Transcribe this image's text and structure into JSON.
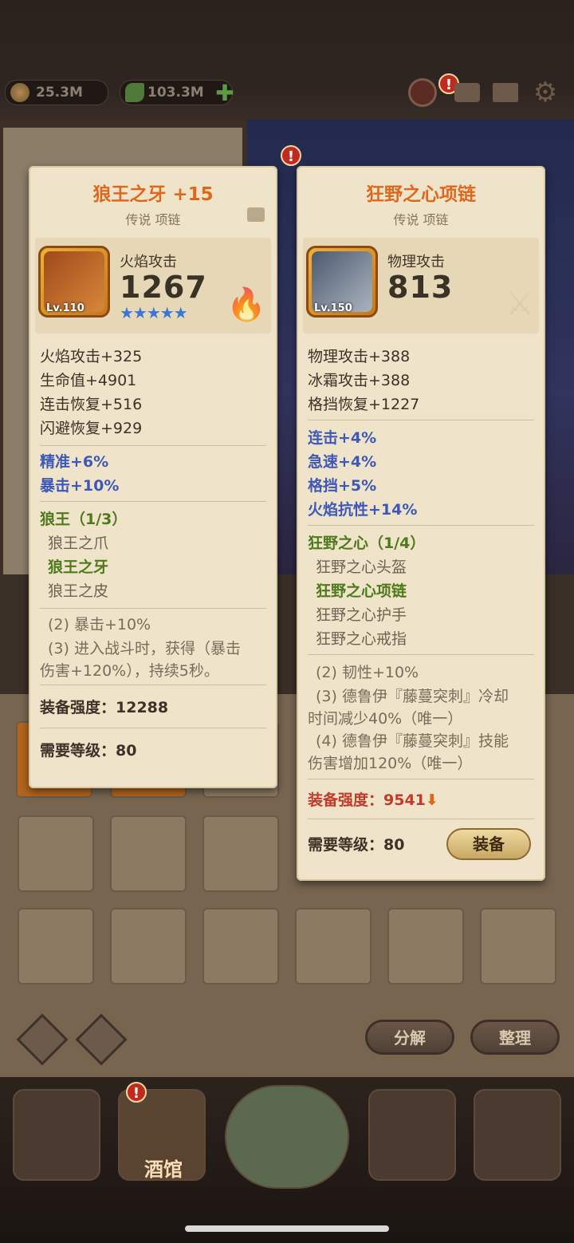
{
  "resources": {
    "coins": "25.3M",
    "gems": "103.3M"
  },
  "top_badges": {
    "bag": "!"
  },
  "card_left": {
    "title": "狼王之牙 +15",
    "subtitle": "传说 项链",
    "level": "Lv.110",
    "main_stat_label": "火焰攻击",
    "main_stat_value": "1267",
    "stars": "★★★★★",
    "stats": [
      "火焰攻击+325",
      "生命值+4901",
      "连击恢复+516",
      "闪避恢复+929"
    ],
    "bonus": [
      "精准+6%",
      "暴击+10%"
    ],
    "set_name": "狼王（1/3）",
    "set_items": [
      "狼王之爪",
      "狼王之牙",
      "狼王之皮"
    ],
    "set_effects": [
      "(2) 暴击+10%",
      "(3) 进入战斗时，获得（暴击",
      "伤害+120%），持续5秒。"
    ],
    "power_label": "装备强度：",
    "power_value": "12288",
    "req_label": "需要等级：",
    "req_value": "80"
  },
  "card_right": {
    "title": "狂野之心项链",
    "subtitle": "传说 项链",
    "level": "Lv.150",
    "main_stat_label": "物理攻击",
    "main_stat_value": "813",
    "stats": [
      "物理攻击+388",
      "冰霜攻击+388",
      "格挡恢复+1227"
    ],
    "bonus": [
      "连击+4%",
      "急速+4%",
      "格挡+5%",
      "火焰抗性+14%"
    ],
    "set_name": "狂野之心（1/4）",
    "set_items": [
      "狂野之心头盔",
      "狂野之心项链",
      "狂野之心护手",
      "狂野之心戒指"
    ],
    "set_effects": [
      "(2) 韧性+10%",
      "(3) 德鲁伊『藤蔓突刺』冷却",
      "时间减少40%（唯一）",
      "(4) 德鲁伊『藤蔓突刺』技能",
      "伤害增加120%（唯一）"
    ],
    "power_label": "装备强度：",
    "power_value": "9541",
    "req_label": "需要等级：",
    "req_value": "80",
    "equip_button": "装备"
  },
  "bottom_buttons": {
    "decompose": "分解",
    "sort": "整理"
  },
  "nav": {
    "tavern": "酒馆"
  }
}
